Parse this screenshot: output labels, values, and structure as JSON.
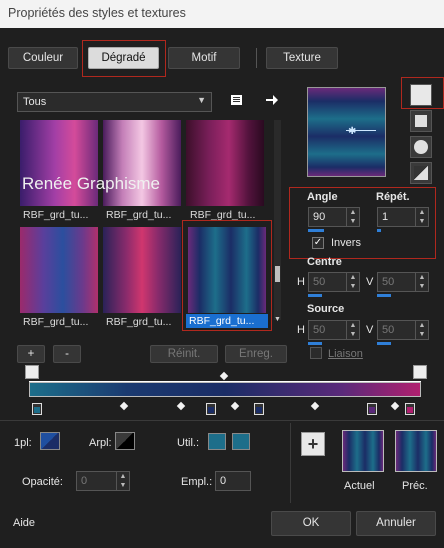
{
  "window": {
    "title": "Propriétés des styles et textures"
  },
  "tabs": [
    {
      "label": "Couleur"
    },
    {
      "label": "Dégradé"
    },
    {
      "label": "Motif"
    },
    {
      "label": "Texture"
    }
  ],
  "category": {
    "selected": "Tous"
  },
  "watermark": "Renée Graphisme",
  "gradients": [
    {
      "label": "RBF_grd_tu..."
    },
    {
      "label": "RBF_grd_tu..."
    },
    {
      "label": "RBF_grd_tu..."
    },
    {
      "label": "RBF_grd_tu..."
    },
    {
      "label": "RBF_grd_tu..."
    },
    {
      "label": "RBF_grd_tu..."
    }
  ],
  "list_buttons": {
    "add": "+",
    "remove": "-",
    "reset": "Réinit.",
    "save": "Enreg."
  },
  "angle": {
    "label": "Angle",
    "value": "90"
  },
  "repeat": {
    "label": "Répét.",
    "value": "1"
  },
  "invert": {
    "label": "Invers",
    "checked": true
  },
  "center": {
    "label": "Centre",
    "h_label": "H",
    "h": "50",
    "v_label": "V",
    "v": "50"
  },
  "source": {
    "label": "Source",
    "h_label": "H",
    "h": "50",
    "v_label": "V",
    "v": "50"
  },
  "link": {
    "label": "Liaison"
  },
  "bottom": {
    "first_label": "1pl:",
    "back_label": "Arpl:",
    "util_label": "Util.:",
    "opacity_label": "Opacité:",
    "opacity_value": "0",
    "location_label": "Empl.:",
    "location_value": "0",
    "current_label": "Actuel",
    "previous_label": "Préc."
  },
  "footer": {
    "help": "Aide",
    "ok": "OK",
    "cancel": "Annuler"
  },
  "colors": {
    "accent": "#2f7fd8",
    "highlight": "#b0281e",
    "teal": "#1d6e8a",
    "navy": "#1b2d66",
    "magenta": "#b0206f"
  }
}
